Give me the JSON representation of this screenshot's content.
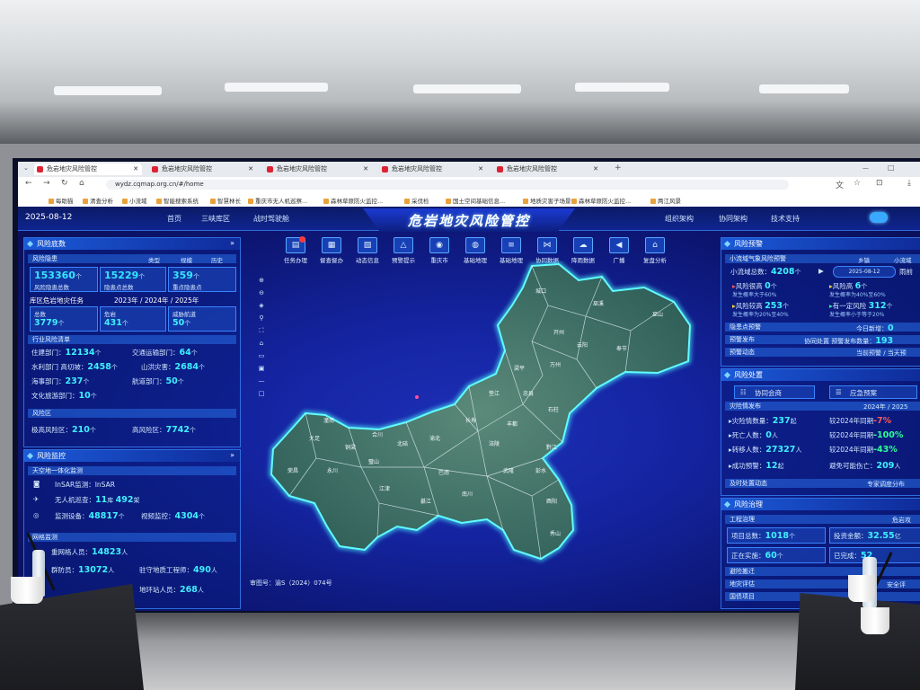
{
  "browser": {
    "tabs": [
      "危岩地灾风险管控",
      "危岩地灾风险管控",
      "危岩地灾风险管控",
      "危岩地灾风险管控",
      "危岩地灾风险管控"
    ],
    "url": "wydz.cqmap.org.cn/#/home",
    "bookmarks": [
      "每助猫",
      "清查分析",
      "小流域",
      "智能搜索系统",
      "智慧林长",
      "重庆市无人机巡察...",
      "森林草原防火监控...",
      "采伐检",
      "国土空间基础信息...",
      "地质灾害子场景",
      "森林草原防火监控...",
      "两江风景"
    ]
  },
  "header": {
    "date": "2025-08-12",
    "title": "危岩地灾风险管控",
    "nav_left": [
      "首页",
      "三峡库区",
      "战时驾驶舱"
    ],
    "nav_right": [
      "组织架构",
      "协同架构",
      "技术支持"
    ]
  },
  "toolbar": [
    "任务办理",
    "督查督办",
    "动态信息",
    "预警提示",
    "重庆市",
    "基础地理",
    "基础地理",
    "协同数据",
    "降雨数据",
    "广播",
    "复盘分析"
  ],
  "left": {
    "risk_base": {
      "title": "风险底数",
      "sub": "风险隐患",
      "tabs": [
        "类型",
        "规模",
        "历史"
      ],
      "stats": [
        {
          "value": "153360",
          "unit": "个",
          "label": "风险隐患总数"
        },
        {
          "value": "15229",
          "unit": "个",
          "label": "隐患点总数"
        },
        {
          "value": "359",
          "unit": "个",
          "label": "重点隐患点"
        }
      ],
      "task_title": "库区危岩地灾任务",
      "task_years": "2023年 / 2024年 / 2025年",
      "tasks": [
        {
          "label": "总数",
          "value": "3779",
          "unit": "个"
        },
        {
          "label": "危岩",
          "value": "431",
          "unit": "个"
        },
        {
          "label": "威胁航道",
          "value": "50",
          "unit": "个"
        }
      ]
    },
    "industry": {
      "title": "行业风险清单",
      "rows": [
        [
          {
            "label": "住建部门：",
            "value": "12134",
            "unit": "个"
          },
          {
            "label": "交通运输部门：",
            "value": "64",
            "unit": "个"
          }
        ],
        [
          {
            "label": "水利部门 高切坡：",
            "value": "2458",
            "unit": "个"
          },
          {
            "label": "山洪灾害：",
            "value": "2684",
            "unit": "个"
          }
        ],
        [
          {
            "label": "海事部门：",
            "value": "237",
            "unit": "个"
          },
          {
            "label": "航道部门：",
            "value": "50",
            "unit": "个"
          }
        ],
        [
          {
            "label": "文化旅游部门：",
            "value": "10",
            "unit": "个"
          }
        ]
      ]
    },
    "zone": {
      "title": "风险区",
      "items": [
        {
          "label": "极高风险区：",
          "value": "210",
          "unit": "个"
        },
        {
          "label": "高风险区：",
          "value": "7742",
          "unit": "个"
        }
      ]
    },
    "monitor": {
      "title": "风险监控",
      "sub1": "天空地一体化监测",
      "insar": "InSAR监测：InSAR",
      "drone_label": "无人机巡查：",
      "drone_value": "11",
      "drone_unit": "库",
      "drone_value2": "492",
      "drone_unit2": "架",
      "device_label": "监测设备：",
      "device_value": "48817",
      "device_unit": "个",
      "video_label": "视频监控：",
      "video_value": "4304",
      "video_unit": "个",
      "sub2": "网格监测",
      "grid_label": "重网格人员：",
      "grid_value": "14823",
      "grid_unit": "人",
      "group_label": "群防员：",
      "group_value": "13072",
      "group_unit": "人",
      "eng_label": "驻守地质工程师：",
      "eng_value": "490",
      "eng_unit": "人",
      "station_label": "地环站人员：",
      "station_value": "268",
      "station_unit": "人"
    }
  },
  "map": {
    "approval": "审图号：渝S（2024）074号",
    "districts": [
      "城口",
      "巫溪",
      "巫山",
      "奉节",
      "开州",
      "云阳",
      "万州",
      "梁平",
      "忠县",
      "垫江",
      "石柱",
      "丰都",
      "长寿",
      "涪陵",
      "武隆",
      "彭水",
      "黔江",
      "酉阳",
      "秀山",
      "南川",
      "綦江",
      "江津",
      "永川",
      "荣昌",
      "大足",
      "潼南",
      "铜梁",
      "合川",
      "璧山",
      "北碚",
      "渝北",
      "巴南"
    ]
  },
  "right": {
    "warning": {
      "title": "风险预警",
      "tabs": [
        "小流域气象风险预警",
        "乡镇",
        "小流域"
      ],
      "total_label": "小流域总数：",
      "total_value": "4208",
      "total_unit": "个",
      "date": "2025-08-12",
      "rain": "雨前",
      "levels": [
        {
          "label": "风险很高",
          "value": "0",
          "unit": "个",
          "note": "发生概率大于60%"
        },
        {
          "label": "风险高",
          "value": "6",
          "unit": "个",
          "note": "发生概率为40%至60%"
        },
        {
          "label": "风险较高",
          "value": "253",
          "unit": "个",
          "note": "发生概率为20%至40%"
        },
        {
          "label": "有一定风险",
          "value": "312",
          "unit": "个",
          "note": "发生概率小于等于20%"
        }
      ],
      "point_label": "隐患点预警",
      "new_label": "今日新增：",
      "new_value": "0",
      "publish_label": "预警发布",
      "publish_text": "协同处置 预警发布数量：",
      "publish_value": "193",
      "dynamic_label": "预警动态",
      "dynamic_text": "当前预警 / 当天预"
    },
    "handling": {
      "title": "风险处置",
      "btn1": "协同会商",
      "btn2": "应急预案",
      "sub": "灾险情发布",
      "years": "2024年 / 2025",
      "rows": [
        {
          "label": "灾险情数量：",
          "value": "237",
          "unit": "起",
          "cmp": "较2024年同期",
          "pct": "-7%",
          "color": "red"
        },
        {
          "label": "死亡人数：",
          "value": "0",
          "unit": "人",
          "cmp": "较2024年同期",
          "pct": "-100%",
          "color": "grn"
        },
        {
          "label": "转移人数：",
          "value": "27327",
          "unit": "人",
          "cmp": "较2024年同期",
          "pct": "-43%",
          "color": "grn"
        }
      ],
      "success_label": "成功预警：",
      "success_value": "12",
      "success_unit": "起",
      "avoid_label": "避免可能伤亡：",
      "avoid_value": "209",
      "avoid_unit": "人",
      "timely": "及时处置动态",
      "expert": "专家调度分布"
    },
    "governance": {
      "title": "风险治理",
      "sub": "工程治理",
      "sub_right": "危岩攻",
      "proj_label": "项目总数：",
      "proj_value": "1018",
      "proj_unit": "个",
      "invest_label": "投资金额：",
      "invest_value": "32.55",
      "invest_unit": "亿",
      "doing_label": "正在实施：",
      "doing_value": "60",
      "doing_unit": "个",
      "done_label": "已完成：",
      "done_value": "52",
      "more": [
        "避险搬迁",
        "地灾评估",
        "国债项目"
      ],
      "more_right": "安全评"
    }
  }
}
